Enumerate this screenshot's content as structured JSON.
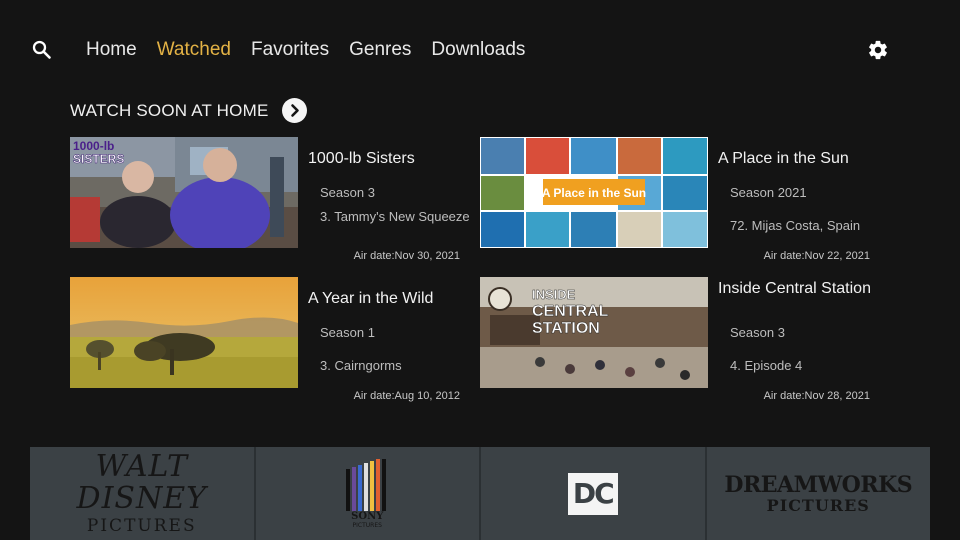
{
  "nav": {
    "items": [
      {
        "label": "Home",
        "active": false
      },
      {
        "label": "Watched",
        "active": true
      },
      {
        "label": "Favorites",
        "active": false
      },
      {
        "label": "Genres",
        "active": false
      },
      {
        "label": "Downloads",
        "active": false
      }
    ],
    "active_color": "#e3b245"
  },
  "section": {
    "title": "WATCH SOON AT HOME"
  },
  "cards": [
    {
      "title": "1000-lb Sisters",
      "season": "Season 3",
      "episode": "3. Tammy's New Squeeze",
      "airdate": "Air date:Nov 30, 2021",
      "thumb_text": "1000-lb SISTERS"
    },
    {
      "title": "A Place in the Sun",
      "season": "Season 2021",
      "episode": "72. Mijas Costa, Spain",
      "airdate": "Air date:Nov 22, 2021",
      "thumb_text": "A Place in the Sun"
    },
    {
      "title": "A Year in the Wild",
      "season": "Season 1",
      "episode": "3. Cairngorms",
      "airdate": "Air date:Aug 10, 2012"
    },
    {
      "title": "Inside Central Station",
      "season": "Season 3",
      "episode": "4. Episode 4",
      "airdate": "Air date:Nov 28, 2021",
      "thumb_text_1": "INSIDE",
      "thumb_text_2": "CENTRAL",
      "thumb_text_3": "STATION"
    }
  ],
  "studios": [
    {
      "line1": "WALT DISNEY",
      "line2": "PICTURES"
    },
    {
      "line1": "SONY",
      "line2": "PICTURES"
    },
    {
      "line1": "DC"
    },
    {
      "line1": "DREAMWORKS",
      "line2": "PICTURES"
    }
  ],
  "icons": {
    "search": "search-icon",
    "settings": "gear-icon",
    "arrow": "chevron-right-icon"
  }
}
